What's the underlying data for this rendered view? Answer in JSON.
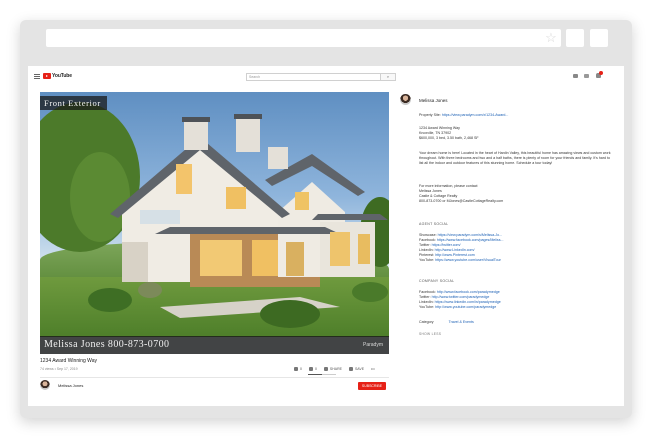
{
  "browser": {},
  "youtube": {
    "logo_text": "YouTube",
    "search_placeholder": "Search"
  },
  "video": {
    "banner_top": "Front Exterior",
    "banner_bottom": "Melissa Jones 800-873-0700",
    "watermark": "Paradym",
    "title": "1234 Award Winning Way",
    "meta": "74 views • Sep 17, 2019",
    "likes": "0",
    "dislikes": "0",
    "share_label": "SHARE",
    "save_label": "SAVE",
    "more_label": "•••",
    "rating_fraction": 0.5
  },
  "channel": {
    "name": "Melissa Jones",
    "subscribe_label": "SUBSCRIBE"
  },
  "description": {
    "author": "Melissa Jones",
    "property_site_label": "Property Site:",
    "property_site_url": "https://view.paradym.com/x/1234-Award...",
    "address_line1": "1234 Award Winning Way",
    "address_line2": "Knoxville, TN 37902",
    "address_line3": "$600,000, 3 bed, 3.50 bath, 2,468 SF",
    "paragraph": "Your dream home is here! Located in the heart of Hardin Valley, this beautiful home has amazing views and custom work throughout. With three bedrooms and two and a half baths, there is plenty of room for your friends and family. It's hard to list all the indoor and outdoor features of this stunning home. Schedule a tour today!",
    "contact_intro": "For more information, please contact",
    "contact_name": "Melissa Jones",
    "contact_company": "Castle & Cottage Realty",
    "contact_phone_email": "800-873-0700 or MJones@CastleCottageRealty.com",
    "agent_social_title": "AGENT SOCIAL",
    "agent_social": [
      {
        "label": "Showcase:",
        "url": "https://view.paradym.com/s/Melissa-Jo..."
      },
      {
        "label": "Facebook:",
        "url": "https://www.facebook.com/pages/Meliss..."
      },
      {
        "label": "Twitter:",
        "url": "https://twitter.com/"
      },
      {
        "label": "LinkedIn:",
        "url": "http://www.LinkedIn.com/"
      },
      {
        "label": "Pinterest:",
        "url": "http://www.Pinterest.com"
      },
      {
        "label": "YouTube:",
        "url": "https://www.youtube.com/user/VisualTour"
      }
    ],
    "company_social_title": "COMPANY SOCIAL",
    "company_social": [
      {
        "label": "Facebook:",
        "url": "http://www.facebook.com/paradymedge"
      },
      {
        "label": "Twitter:",
        "url": "http://www.twitter.com/paradymedge"
      },
      {
        "label": "LinkedIn:",
        "url": "https://www.linkedin.com/in/paradymedge"
      },
      {
        "label": "YouTube:",
        "url": "http://www.youtube.com/paradymedge"
      }
    ],
    "category_label": "Category",
    "category_value": "Travel & Events",
    "show_less": "SHOW LESS"
  },
  "colors": {
    "brand_red": "#e62117",
    "link_blue": "#1a5fb4"
  }
}
